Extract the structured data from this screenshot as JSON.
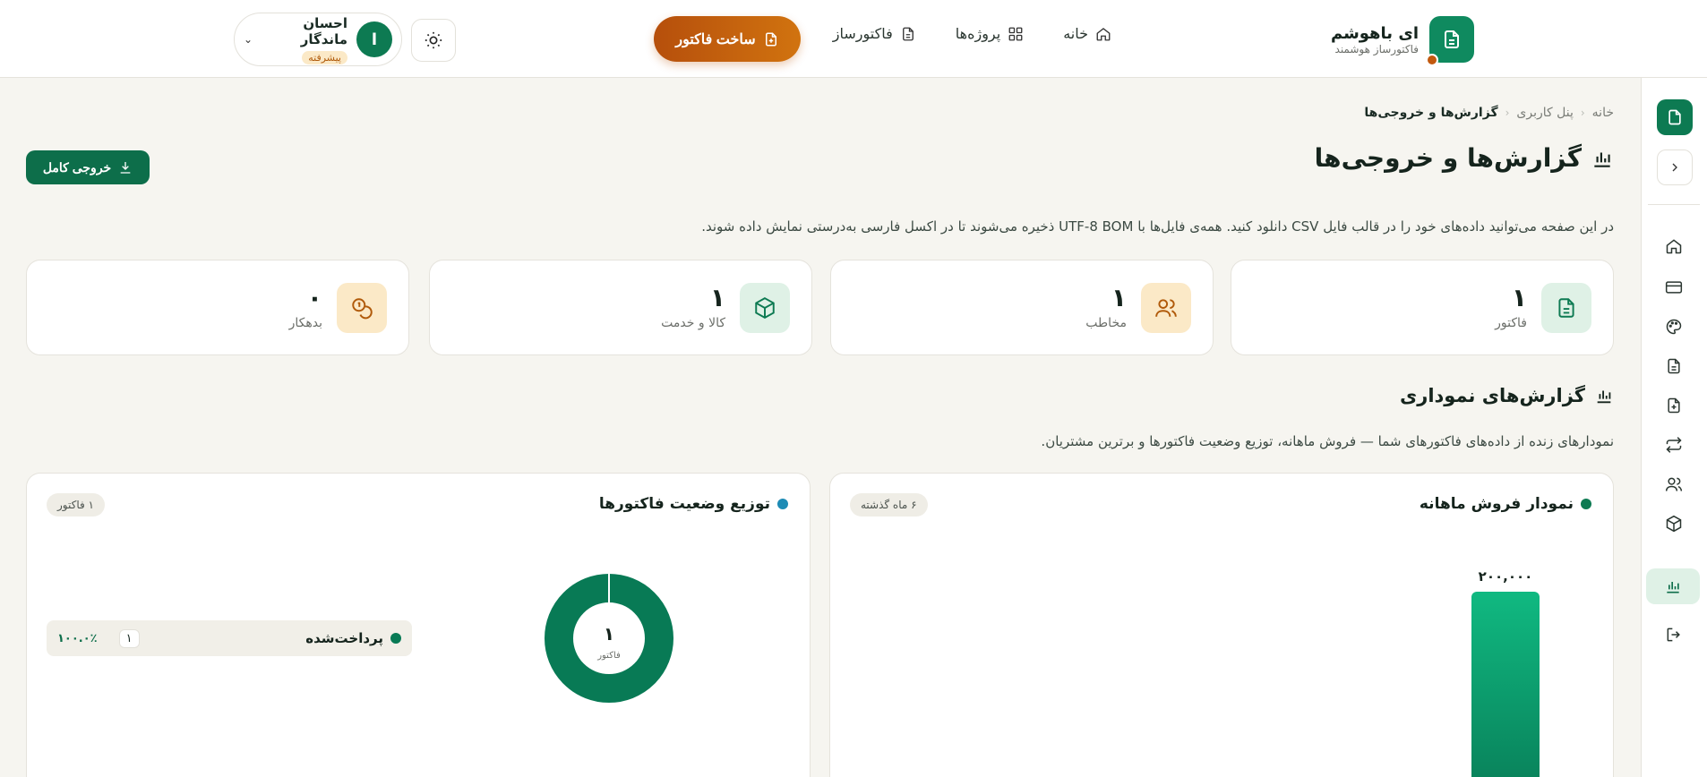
{
  "brand": {
    "title": "ای باهوشم",
    "subtitle": "فاکتورساز هوشمند"
  },
  "nav": {
    "home": "خانه",
    "projects": "پروژه‌ها",
    "invoice_builder": "فاکتورساز"
  },
  "create_button": "ساخت فاکتور",
  "user": {
    "name": "احسان ماندگار",
    "badge": "پیشرفته",
    "initial": "ا"
  },
  "breadcrumb": {
    "home": "خانه",
    "panel": "پنل کاربری",
    "current": "گزارش‌ها و خروجی‌ها"
  },
  "page": {
    "title": "گزارش‌ها و خروجی‌ها",
    "export_button": "خروجی کامل",
    "description": "در این صفحه می‌توانید داده‌های خود را در قالب فایل CSV دانلود کنید. همه‌ی فایل‌ها با UTF-8 BOM ذخیره می‌شوند تا در اکسل فارسی به‌درستی نمایش داده شوند."
  },
  "stats": [
    {
      "value": "۱",
      "label": "فاکتور",
      "icon": "file-icon",
      "tone": "green"
    },
    {
      "value": "۱",
      "label": "مخاطب",
      "icon": "users-icon",
      "tone": "amber"
    },
    {
      "value": "۱",
      "label": "کالا و خدمت",
      "icon": "box-icon",
      "tone": "green"
    },
    {
      "value": "۰",
      "label": "بدهکار",
      "icon": "coins-icon",
      "tone": "amber"
    }
  ],
  "charts_section": {
    "title": "گزارش‌های نموداری",
    "description": "نمودارهای زنده از داده‌های فاکتورهای شما — فروش ماهانه، توزیع وضعیت فاکتورها و برترین مشتریان."
  },
  "sales_panel": {
    "title": "نمودار فروش ماهانه",
    "chip": "۶ ماه گذشته",
    "dot_color": "#0d7a52"
  },
  "status_panel": {
    "title": "توزیع وضعیت فاکتورها",
    "chip": "۱ فاکتور",
    "dot_color": "#1d8bb5",
    "center_value": "۱",
    "center_label": "فاکتور",
    "legend": {
      "name": "پرداخت‌شده",
      "count": "۱",
      "percent": "۱۰۰.۰٪"
    }
  },
  "chart_data": [
    {
      "type": "bar",
      "title": "نمودار فروش ماهانه",
      "values": [
        200000
      ],
      "data_labels": [
        "۲۰۰,۰۰۰"
      ],
      "color": "#0f9e6a"
    },
    {
      "type": "pie",
      "title": "توزیع وضعیت فاکتورها",
      "categories": [
        "پرداخت‌شده"
      ],
      "values": [
        1
      ],
      "percent": [
        100.0
      ],
      "colors": [
        "#087a55"
      ]
    }
  ],
  "colors": {
    "primary": "#0d7a52",
    "accent": "#c2590f",
    "background": "#f6f5f0"
  }
}
